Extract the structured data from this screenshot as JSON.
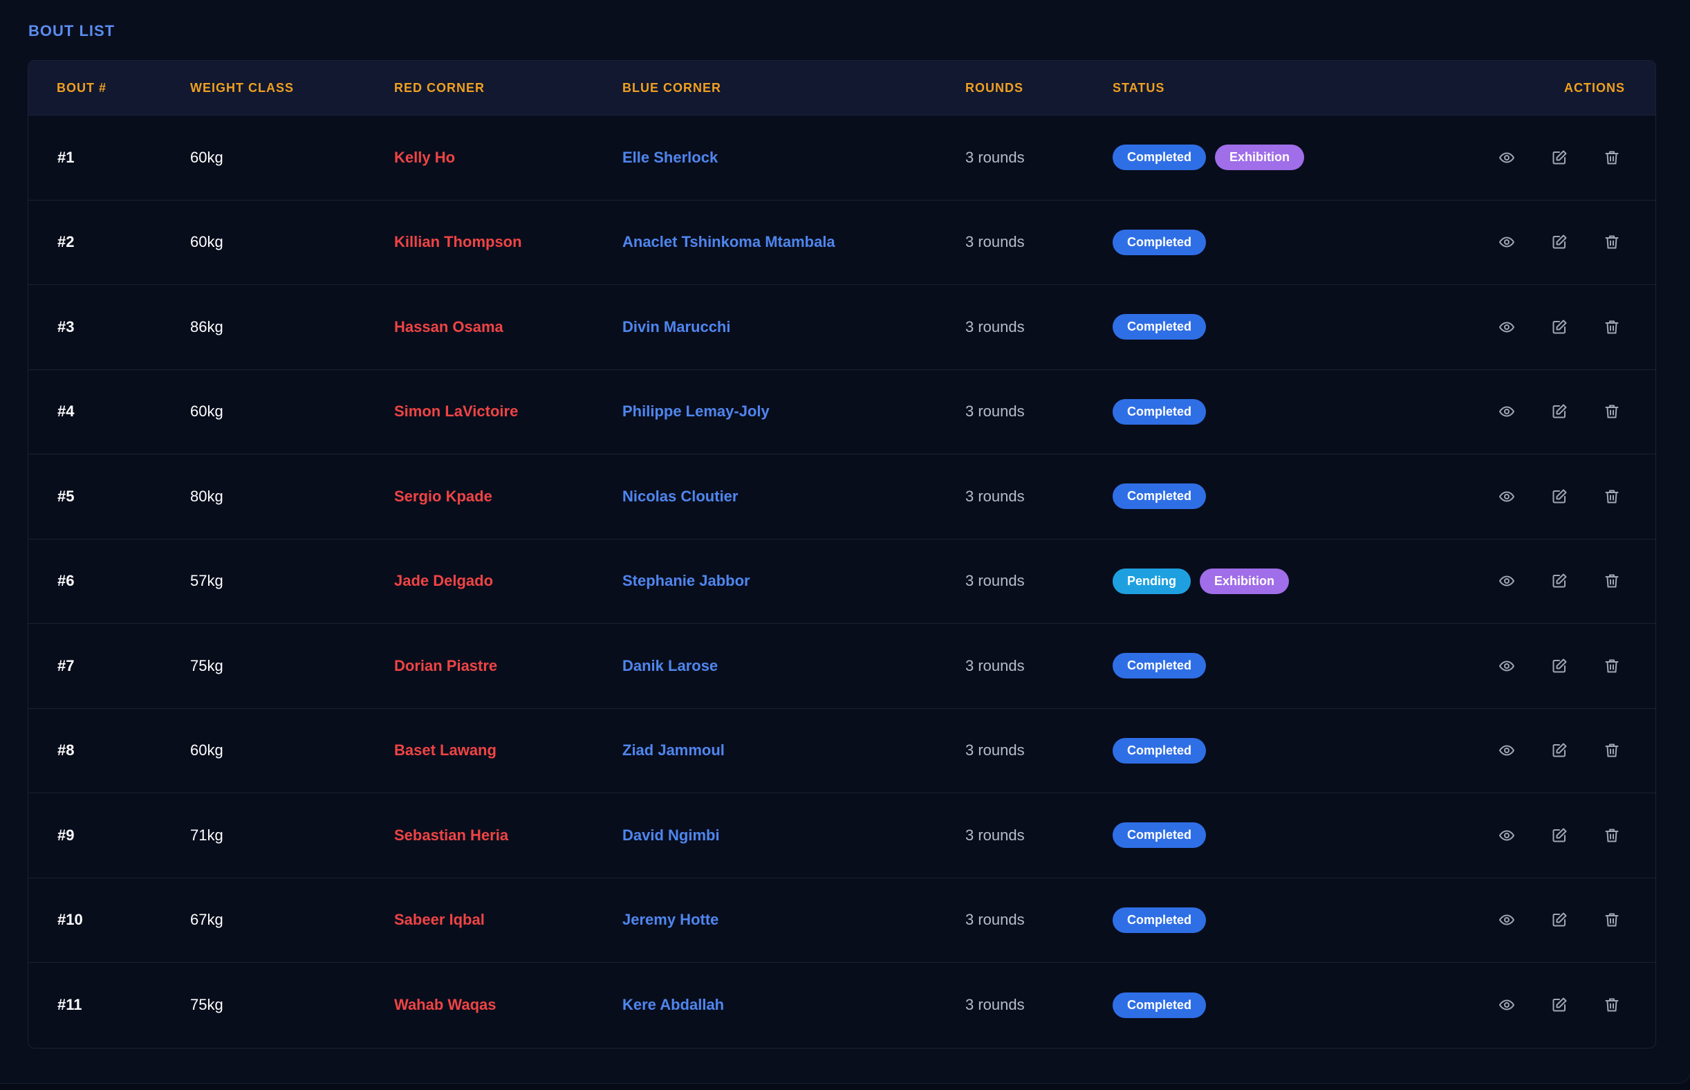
{
  "section_title": "BOUT LIST",
  "columns": {
    "bout": "BOUT #",
    "weight": "WEIGHT CLASS",
    "red": "RED CORNER",
    "blue": "BLUE CORNER",
    "rounds": "ROUNDS",
    "status": "STATUS",
    "actions": "ACTIONS"
  },
  "colors": {
    "header_text": "#f0a020",
    "red_corner": "#ef4444",
    "blue_corner": "#4f86ee",
    "completed_badge": "#2f6fe6",
    "pending_badge": "#1ea0e0",
    "exhibition_badge": "#a06ee8"
  },
  "actions_icons": [
    "eye-icon",
    "edit-icon",
    "trash-icon"
  ],
  "bouts": [
    {
      "bout": "#1",
      "weight": "60kg",
      "red": "Kelly Ho",
      "blue": "Elle Sherlock",
      "rounds": "3 rounds",
      "status": "Completed",
      "tag": "Exhibition"
    },
    {
      "bout": "#2",
      "weight": "60kg",
      "red": "Killian Thompson",
      "blue": "Anaclet Tshinkoma Mtambala",
      "rounds": "3 rounds",
      "status": "Completed",
      "tag": ""
    },
    {
      "bout": "#3",
      "weight": "86kg",
      "red": "Hassan Osama",
      "blue": "Divin Marucchi",
      "rounds": "3 rounds",
      "status": "Completed",
      "tag": ""
    },
    {
      "bout": "#4",
      "weight": "60kg",
      "red": "Simon LaVictoire",
      "blue": "Philippe Lemay-Joly",
      "rounds": "3 rounds",
      "status": "Completed",
      "tag": ""
    },
    {
      "bout": "#5",
      "weight": "80kg",
      "red": "Sergio Kpade",
      "blue": "Nicolas Cloutier",
      "rounds": "3 rounds",
      "status": "Completed",
      "tag": ""
    },
    {
      "bout": "#6",
      "weight": "57kg",
      "red": "Jade Delgado",
      "blue": "Stephanie Jabbor",
      "rounds": "3 rounds",
      "status": "Pending",
      "tag": "Exhibition"
    },
    {
      "bout": "#7",
      "weight": "75kg",
      "red": "Dorian Piastre",
      "blue": "Danik Larose",
      "rounds": "3 rounds",
      "status": "Completed",
      "tag": ""
    },
    {
      "bout": "#8",
      "weight": "60kg",
      "red": "Baset Lawang",
      "blue": "Ziad Jammoul",
      "rounds": "3 rounds",
      "status": "Completed",
      "tag": ""
    },
    {
      "bout": "#9",
      "weight": "71kg",
      "red": "Sebastian Heria",
      "blue": "David Ngimbi",
      "rounds": "3 rounds",
      "status": "Completed",
      "tag": ""
    },
    {
      "bout": "#10",
      "weight": "67kg",
      "red": "Sabeer Iqbal",
      "blue": "Jeremy Hotte",
      "rounds": "3 rounds",
      "status": "Completed",
      "tag": ""
    },
    {
      "bout": "#11",
      "weight": "75kg",
      "red": "Wahab Waqas",
      "blue": "Kere Abdallah",
      "rounds": "3 rounds",
      "status": "Completed",
      "tag": ""
    }
  ]
}
